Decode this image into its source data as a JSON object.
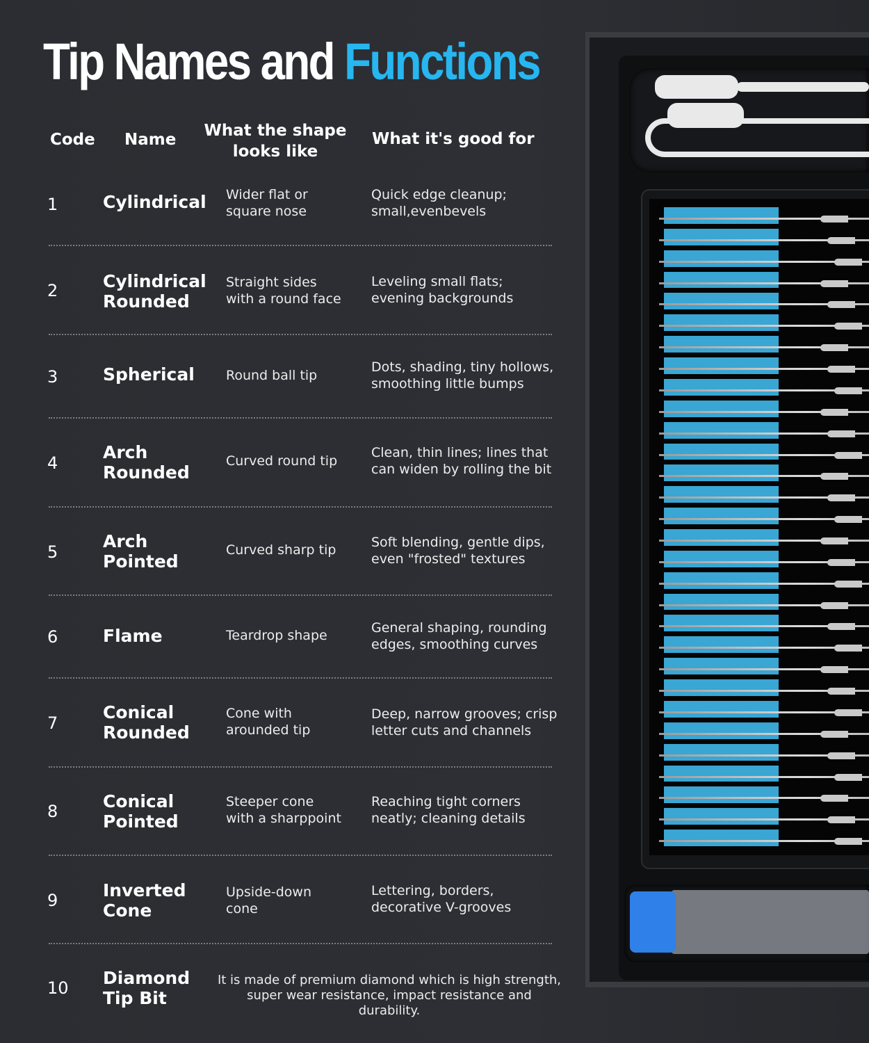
{
  "title": {
    "part1": "Tip Names and",
    "part2": "Functions"
  },
  "headers": {
    "code": "Code",
    "name": "Name",
    "shape_line1": "What the shape",
    "shape_line2": "looks like",
    "good": "What it's good for"
  },
  "rows": [
    {
      "code": "1",
      "name_l1": "Cylindrical",
      "name_l2": "",
      "shape_l1": "Wider flat or",
      "shape_l2": "square nose",
      "good_l1": "Quick edge cleanup;",
      "good_l2": "small,evenbevels"
    },
    {
      "code": "2",
      "name_l1": "Cylindrical",
      "name_l2": "Rounded",
      "shape_l1": "Straight sides",
      "shape_l2": "with a round face",
      "good_l1": "Leveling small flats;",
      "good_l2": "evening backgrounds"
    },
    {
      "code": "3",
      "name_l1": "Spherical",
      "name_l2": "",
      "shape_l1": "Round ball tip",
      "shape_l2": "",
      "good_l1": "Dots, shading, tiny hollows,",
      "good_l2": "smoothing little bumps"
    },
    {
      "code": "4",
      "name_l1": "Arch",
      "name_l2": "Rounded",
      "shape_l1": "Curved round tip",
      "shape_l2": "",
      "good_l1": "Clean, thin lines; lines that",
      "good_l2": "can widen by rolling the bit"
    },
    {
      "code": "5",
      "name_l1": "Arch",
      "name_l2": "Pointed",
      "shape_l1": "Curved sharp tip",
      "shape_l2": "",
      "good_l1": "Soft blending, gentle dips,",
      "good_l2": "even \"frosted\" textures"
    },
    {
      "code": "6",
      "name_l1": "Flame",
      "name_l2": "",
      "shape_l1": "Teardrop shape",
      "shape_l2": "",
      "good_l1": "General shaping, rounding",
      "good_l2": "edges, smoothing curves"
    },
    {
      "code": "7",
      "name_l1": "Conical",
      "name_l2": "Rounded",
      "shape_l1": "Cone with",
      "shape_l2": "arounded tip",
      "good_l1": "Deep, narrow grooves; crisp",
      "good_l2": "letter cuts and channels"
    },
    {
      "code": "8",
      "name_l1": "Conical",
      "name_l2": "Pointed",
      "shape_l1": "Steeper cone",
      "shape_l2": "with a sharppoint",
      "good_l1": "Reaching tight corners",
      "good_l2": "neatly; cleaning details"
    },
    {
      "code": "9",
      "name_l1": "Inverted",
      "name_l2": "Cone",
      "shape_l1": "Upside-down",
      "shape_l2": "cone",
      "good_l1": "Lettering, borders,",
      "good_l2": "decorative V-grooves"
    }
  ],
  "last_row": {
    "code": "10",
    "name_l1": "Diamond",
    "name_l2": "Tip Bit",
    "desc_l1": "It is made of premium diamond which is high strength,",
    "desc_l2": "super wear resistance, impact resistance and durability."
  },
  "colors": {
    "background": "#2b2d32",
    "accent": "#27b6f0",
    "tray_blue": "#39a6d3",
    "separator": "#7b7e85"
  }
}
